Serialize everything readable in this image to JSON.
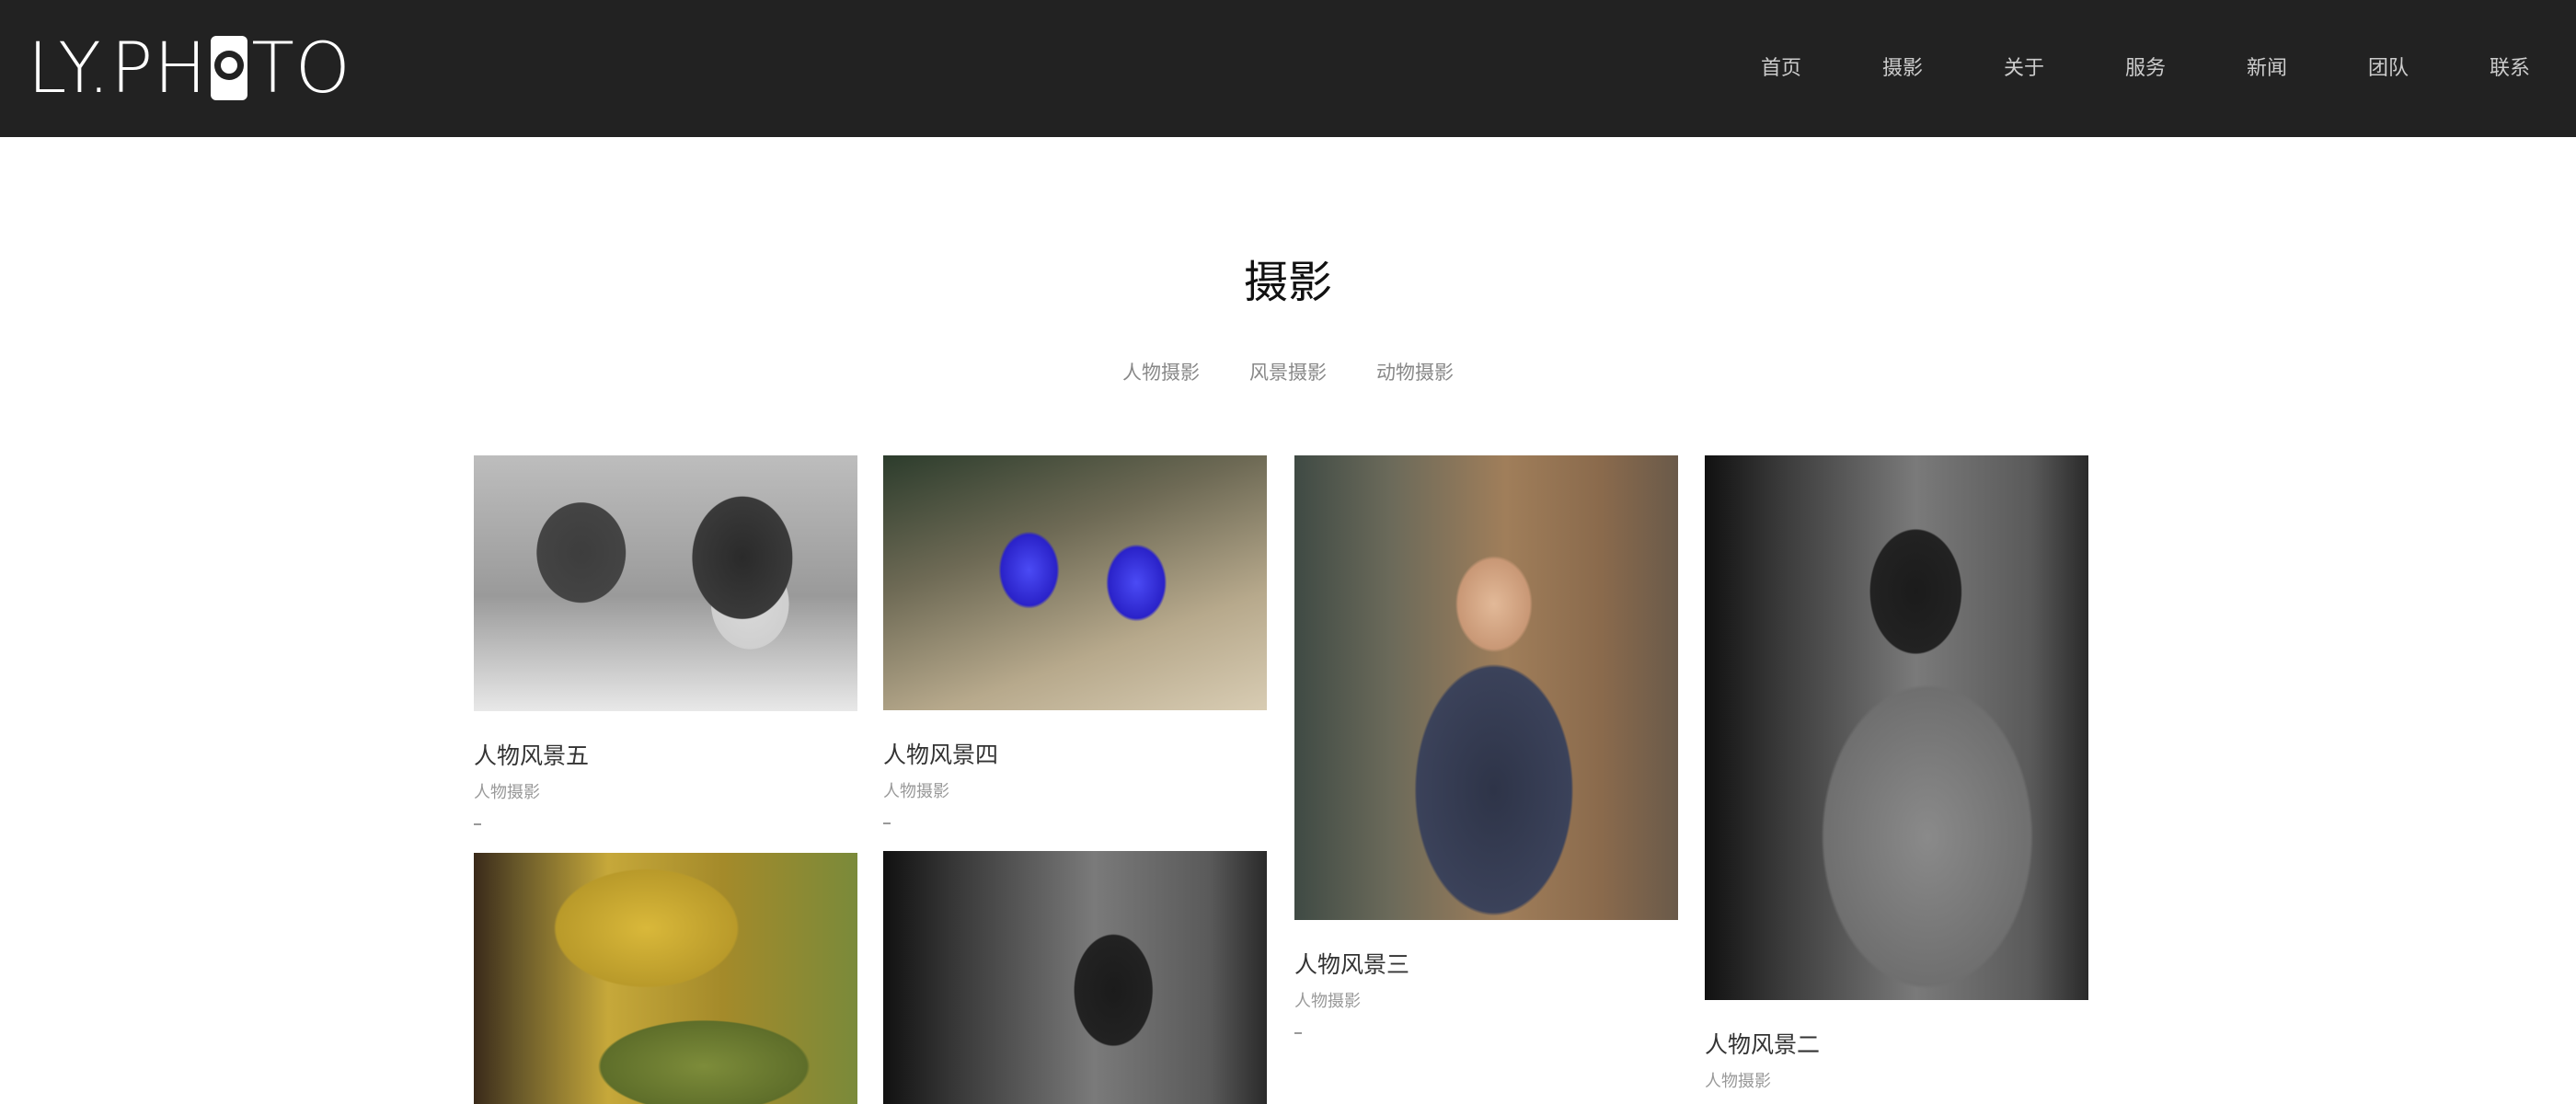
{
  "header": {
    "logo_text_left": "LY.PH",
    "logo_text_right": "TO",
    "nav": [
      {
        "label": "首页"
      },
      {
        "label": "摄影"
      },
      {
        "label": "关于"
      },
      {
        "label": "服务"
      },
      {
        "label": "新闻"
      },
      {
        "label": "团队"
      },
      {
        "label": "联系"
      }
    ]
  },
  "main": {
    "title": "摄影",
    "filters": [
      {
        "label": "人物摄影"
      },
      {
        "label": "风景摄影"
      },
      {
        "label": "动物摄影"
      }
    ],
    "cards": [
      {
        "title": "人物风景五",
        "category": "人物摄影",
        "image": "children-photo"
      },
      {
        "title": "人物风景四",
        "category": "人物摄影",
        "image": "blue-flower-photo"
      },
      {
        "title": "人物风景三",
        "category": "人物摄影",
        "image": "boy-in-suit-photo"
      },
      {
        "title": "人物风景二",
        "category": "人物摄影",
        "image": "woman-portrait-photo"
      },
      {
        "title": "",
        "category": "",
        "image": "autumn-forest-photo"
      },
      {
        "title": "",
        "category": "",
        "image": "woman-portrait-photo"
      }
    ]
  },
  "colors": {
    "header_bg": "#222222",
    "nav_text": "#cccccc",
    "title_text": "#111111",
    "filter_text": "#888888"
  }
}
